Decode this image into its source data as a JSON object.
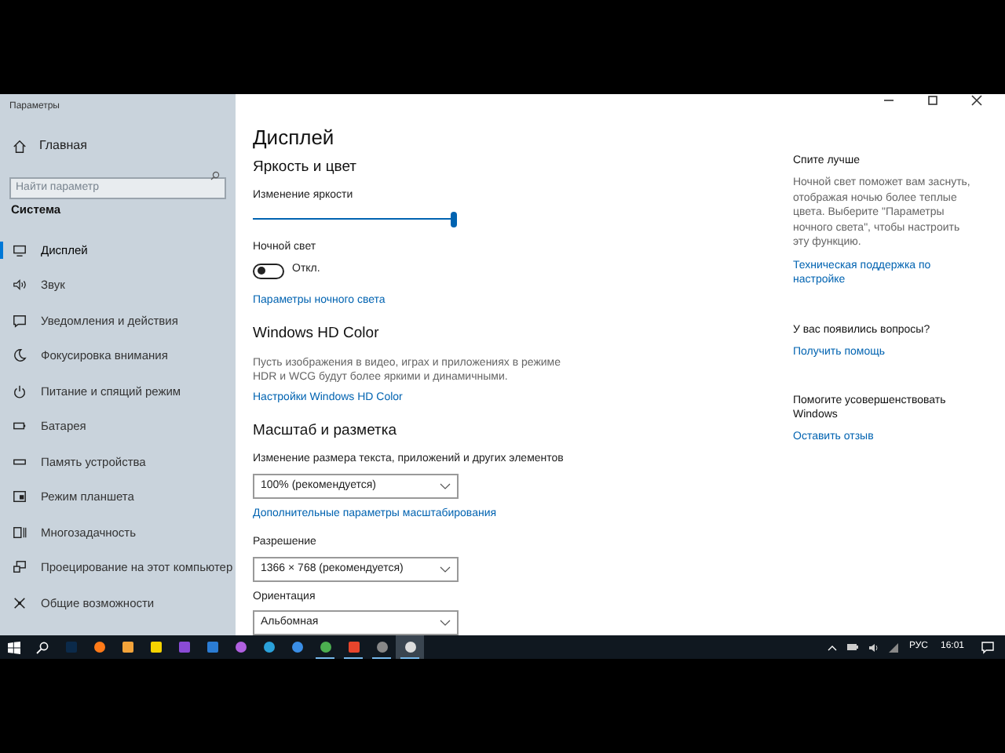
{
  "window": {
    "title": "Параметры"
  },
  "sidebar": {
    "home": "Главная",
    "search": {
      "placeholder": "Найти параметр"
    },
    "section": "Система",
    "items": [
      {
        "label": "Дисплей",
        "selected": true
      },
      {
        "label": "Звук",
        "selected": false
      },
      {
        "label": "Уведомления и действия",
        "selected": false
      },
      {
        "label": "Фокусировка внимания",
        "selected": false
      },
      {
        "label": "Питание и спящий режим",
        "selected": false
      },
      {
        "label": "Батарея",
        "selected": false
      },
      {
        "label": "Память устройства",
        "selected": false
      },
      {
        "label": "Режим планшета",
        "selected": false
      },
      {
        "label": "Многозадачность",
        "selected": false
      },
      {
        "label": "Проецирование на этот компьютер",
        "selected": false
      },
      {
        "label": "Общие возможности",
        "selected": false
      }
    ]
  },
  "main": {
    "title": "Дисплей",
    "sections": [
      {
        "kind": "heading",
        "text": "Яркость и цвет"
      },
      {
        "kind": "slider",
        "label": "Изменение яркости",
        "level": 1
      },
      {
        "kind": "toggle",
        "label": "Ночной свет",
        "on": false,
        "state": "Откл."
      },
      {
        "kind": "link",
        "text": "Параметры ночного света"
      },
      {
        "kind": "heading",
        "text": "Windows HD Color"
      },
      {
        "kind": "desc",
        "text": "Пусть изображения в видео, играх и приложениях в режиме HDR и WCG будут более яркими и динамичными."
      },
      {
        "kind": "link",
        "text": "Настройки Windows HD Color"
      },
      {
        "kind": "heading",
        "text": "Масштаб и разметка"
      },
      {
        "kind": "dropdown",
        "label": "Изменение размера текста, приложений и других элементов",
        "value": "100% (рекомендуется)"
      },
      {
        "kind": "link",
        "text": "Дополнительные параметры масштабирования"
      },
      {
        "kind": "dropdown",
        "label": "Разрешение",
        "value": "1366 × 768 (рекомендуется)"
      },
      {
        "kind": "dropdown",
        "label": "Ориентация",
        "value": "Альбомная"
      }
    ]
  },
  "aside": [
    {
      "title": "Спите лучше",
      "text": "Ночной свет поможет вам заснуть, отображая ночью более теплые цвета. Выберите \"Параметры ночного света\", чтобы настроить эту функцию.",
      "link": "Техническая поддержка по настройке"
    },
    {
      "title": "У вас появились вопросы?",
      "link": "Получить помощь"
    },
    {
      "title": "Помогите усовершенствовать Windows",
      "link": "Оставить отзыв"
    }
  ],
  "taskbar": {
    "apps": [
      {
        "running": false,
        "selected": false
      },
      {
        "running": false,
        "selected": false
      },
      {
        "running": false,
        "selected": false
      },
      {
        "running": false,
        "selected": false
      },
      {
        "running": false,
        "selected": false
      },
      {
        "running": false,
        "selected": false
      },
      {
        "running": false,
        "selected": false
      },
      {
        "running": false,
        "selected": false
      },
      {
        "running": false,
        "selected": false
      },
      {
        "running": true,
        "selected": false
      },
      {
        "running": true,
        "selected": false
      },
      {
        "running": true,
        "selected": false
      },
      {
        "running": true,
        "selected": true
      }
    ],
    "language": "РУС",
    "time": "16:01"
  }
}
